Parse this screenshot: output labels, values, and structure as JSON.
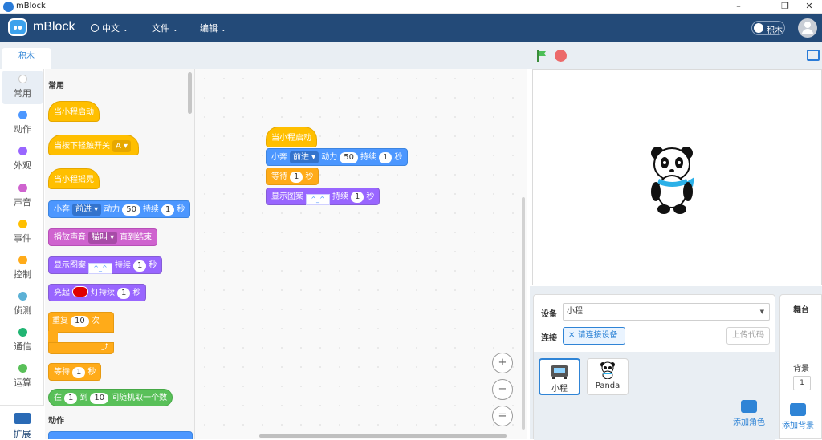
{
  "window": {
    "title": "mBlock",
    "min": "–",
    "max": "❐",
    "close": "✕"
  },
  "menubar": {
    "brand": "mBlock",
    "language": "中文",
    "file": "文件",
    "edit": "编辑",
    "mode_toggle": "积木"
  },
  "tabs": {
    "blocks": "积木"
  },
  "categories": [
    "常用",
    "动作",
    "外观",
    "声音",
    "事件",
    "控制",
    "侦测",
    "通信",
    "运算"
  ],
  "category_colors": [
    "#ffffff",
    "#4c97ff",
    "#9966ff",
    "#cf63cf",
    "#ffbf00",
    "#ffab19",
    "#5cb1d6",
    "#21b573",
    "#59c059",
    "#ff8c1a"
  ],
  "extensions": "扩展",
  "palette": {
    "section_common": "常用",
    "section_motion": "动作",
    "when_start": "当小程启动",
    "when_touch": "当按下轻触开关",
    "touch_value": "A",
    "when_shake": "当小程摇晃",
    "move_prefix": "小奔",
    "move_dir": "前进",
    "move_power": "动力",
    "move_power_val": "50",
    "move_dur": "持续",
    "move_dur_val": "1",
    "sec": "秒",
    "play_sound": "播放声音",
    "sound_name": "猫叫",
    "until_done": "直到结束",
    "show_pattern": "显示图案",
    "pattern_dur": "持续",
    "pattern_val": "1",
    "light_on": "亮起",
    "light_dur": "灯持续",
    "light_val": "1",
    "repeat": "重复",
    "repeat_val": "10",
    "times": "次",
    "loop_arrow": "⤴",
    "wait": "等待",
    "wait_val": "1",
    "random_prefix": "在",
    "random_from": "1",
    "random_to_label": "到",
    "random_to": "10",
    "random_suffix": "间随机取一个数"
  },
  "script": {
    "hat": "当小程启动",
    "move_prefix": "小奔",
    "move_dir": "前进",
    "move_power": "动力",
    "move_power_val": "50",
    "move_dur": "持续",
    "move_dur_val": "1",
    "sec": "秒",
    "wait": "等待",
    "wait_val": "1",
    "show_pattern": "显示图案",
    "pattern_dur": "持续",
    "pattern_val": "1"
  },
  "zoom": {
    "in": "+",
    "out": "−",
    "reset": "="
  },
  "device_panel": {
    "device_label": "设备",
    "device_value": "小程",
    "connect_label": "连接",
    "connect_button": "请连接设备",
    "upload_button": "上传代码",
    "devices": [
      "小程",
      "Panda"
    ],
    "add_sprite": "添加角色"
  },
  "stage_panel": {
    "title": "舞台",
    "background_label": "背景",
    "background_count": "1",
    "add_background": "添加背景"
  }
}
